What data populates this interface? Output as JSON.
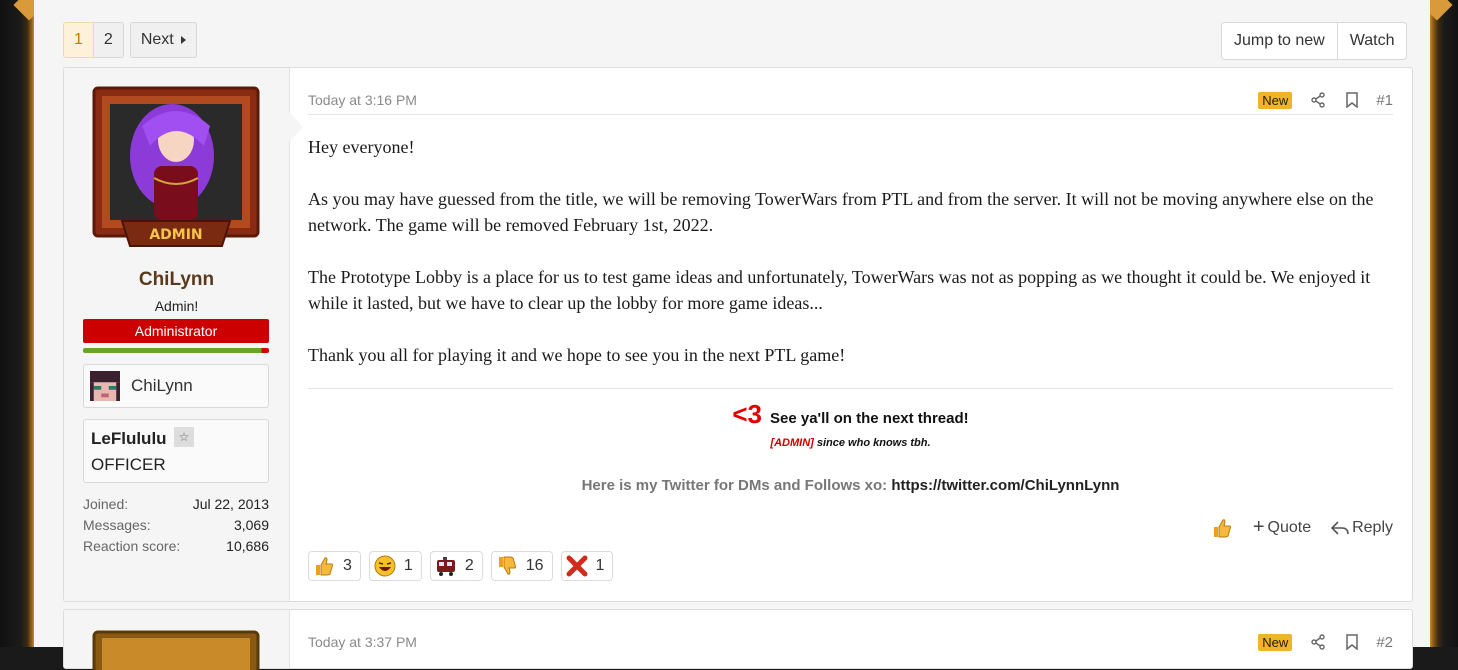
{
  "pagination": {
    "pages": [
      "1",
      "2"
    ],
    "current": "1",
    "next_label": "Next"
  },
  "thread_tools": {
    "jump_label": "Jump to new",
    "watch_label": "Watch"
  },
  "post1": {
    "user": {
      "avatar_badge": "ADMIN",
      "name": "ChiLynn",
      "title": "Admin!",
      "banner": "Administrator",
      "minecraft_name": "ChiLynn",
      "guild_name": "LeFlululu",
      "guild_rank": "OFFICER",
      "stats": [
        {
          "label": "Joined:",
          "value": "Jul 22, 2013"
        },
        {
          "label": "Messages:",
          "value": "3,069"
        },
        {
          "label": "Reaction score:",
          "value": "10,686"
        }
      ]
    },
    "time": "Today at 3:16 PM",
    "badge": "New",
    "number": "#1",
    "paragraphs": [
      "Hey everyone!",
      "As you may have guessed from the title, we will be removing TowerWars from PTL and from the server. It will not be moving anywhere else on the network. The game will be removed February 1st, 2022.",
      "The Prototype Lobby is a place for us to test game ideas and unfortunately, TowerWars was not as popping as we thought it could be. We enjoyed it while it lasted, but we have to clear up the lobby for more game ideas...",
      "Thank you all for playing it and we hope to see you in the next PTL game!"
    ],
    "signature": {
      "heart": "<3",
      "line1": "See ya'll on the next thread!",
      "admin_tag": "[ADMIN]",
      "line2": " since who knows tbh.",
      "line3": "Here is my Twitter for DMs and Follows xo: ",
      "link": "https://twitter.com/ChiLynnLynn"
    },
    "actions": {
      "quote_label": "Quote",
      "reply_label": "Reply"
    },
    "reactions": [
      {
        "icon": "thumbs-up-icon",
        "count": "3"
      },
      {
        "icon": "laugh-icon",
        "count": "1"
      },
      {
        "icon": "train-icon",
        "count": "2"
      },
      {
        "icon": "thumbs-down-icon",
        "count": "16"
      },
      {
        "icon": "red-x-icon",
        "count": "1"
      }
    ]
  },
  "post2": {
    "time": "Today at 3:37 PM",
    "badge": "New",
    "number": "#2"
  }
}
